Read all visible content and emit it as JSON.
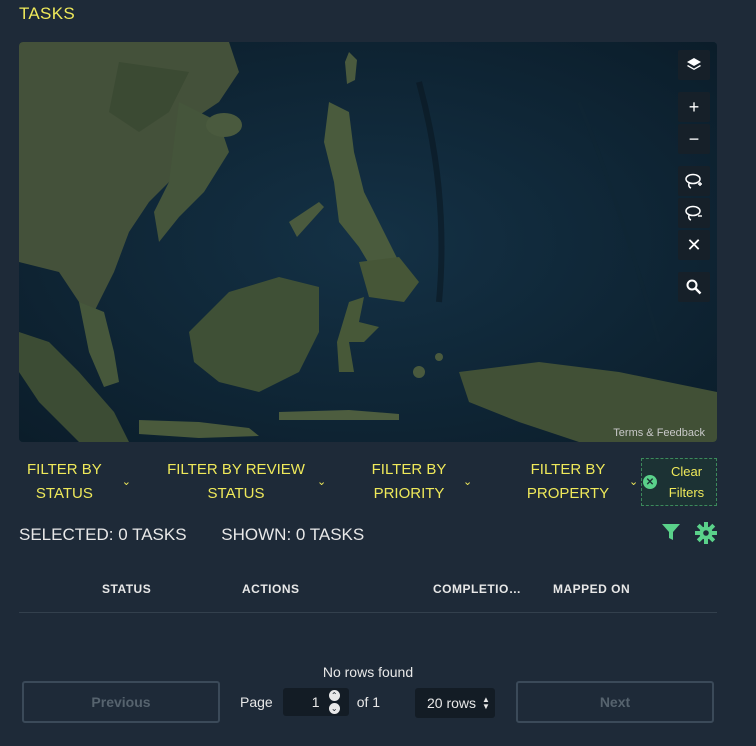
{
  "page": {
    "title": "TASKS"
  },
  "map": {
    "attribution": "Terms & Feedback",
    "controls": [
      {
        "name": "layers-icon",
        "glyph": "layers"
      },
      {
        "name": "zoom-in-button",
        "glyph": "+"
      },
      {
        "name": "zoom-out-button",
        "glyph": "−"
      },
      {
        "name": "lasso-add-icon",
        "glyph": "lasso+"
      },
      {
        "name": "lasso-remove-icon",
        "glyph": "lasso-"
      },
      {
        "name": "clear-selection-icon",
        "glyph": "✕"
      },
      {
        "name": "search-icon",
        "glyph": "search"
      }
    ]
  },
  "filters": {
    "status": "FILTER BY STATUS",
    "review_status": "FILTER BY REVIEW STATUS",
    "priority": "FILTER BY PRIORITY",
    "property": "FILTER BY PROPERTY",
    "clear": "Clear Filters"
  },
  "counts": {
    "selected": "SELECTED: 0 TASKS",
    "shown": "SHOWN: 0 TASKS"
  },
  "table": {
    "columns": [
      "STATUS",
      "ACTIONS",
      "COMPLETIO…",
      "MAPPED ON"
    ],
    "empty_text": "No rows found"
  },
  "pagination": {
    "previous": "Previous",
    "next": "Next",
    "page_label": "Page",
    "page_value": "1",
    "of_label": "of 1",
    "rows_value": "20 rows"
  },
  "colors": {
    "accent": "#efe95a",
    "green": "#5ad18a",
    "background": "#1e2a38"
  }
}
